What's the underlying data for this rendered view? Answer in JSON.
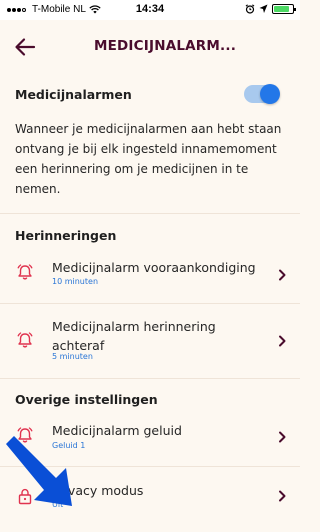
{
  "status_bar": {
    "carrier": "T-Mobile NL",
    "time": "14:34"
  },
  "header": {
    "title": "MEDICIJNALARM..."
  },
  "main_toggle": {
    "label": "Medicijnalarmen",
    "enabled": true
  },
  "description": "Wanneer je medicijnalarmen aan hebt staan ontvang je bij elk ingesteld innamemoment een herinnering om je medicijnen in te nemen.",
  "sections": {
    "reminders_title": "Herinneringen",
    "other_title": "Overige instellingen"
  },
  "rows": {
    "pre_announcement": {
      "title": "Medicijnalarm vooraankondiging",
      "value": "10 minuten",
      "icon": "alarm-bell-icon"
    },
    "follow_up": {
      "title": "Medicijnalarm herinnering achteraf",
      "value": "5 minuten",
      "icon": "alarm-bell-icon"
    },
    "sound": {
      "title": "Medicijnalarm geluid",
      "value": "Geluid 1",
      "icon": "alarm-bell-icon"
    },
    "privacy": {
      "title": "Privacy modus",
      "value": "Uit",
      "icon": "lock-icon"
    }
  },
  "colors": {
    "background": "#fdf8f1",
    "title": "#4a0c2d",
    "accent_red": "#e0334f",
    "link_blue": "#2b76d6",
    "toggle_blue": "#2377e8",
    "arrow_blue": "#0a4fd6"
  }
}
